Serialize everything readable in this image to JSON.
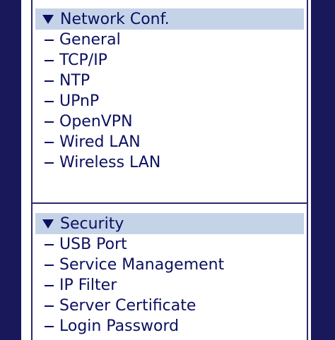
{
  "network": {
    "title": "Network Conf.",
    "items": [
      {
        "label": "General"
      },
      {
        "label": "TCP/IP"
      },
      {
        "label": "NTP"
      },
      {
        "label": "UPnP"
      },
      {
        "label": "OpenVPN"
      },
      {
        "label": "Wired LAN"
      },
      {
        "label": "Wireless LAN"
      }
    ]
  },
  "security": {
    "title": "Security",
    "items": [
      {
        "label": "USB Port"
      },
      {
        "label": "Service Management"
      },
      {
        "label": "IP Filter"
      },
      {
        "label": "Server Certificate"
      },
      {
        "label": "Login Password"
      }
    ]
  },
  "colors": {
    "navy": "#18185a",
    "header_bg": "#c5d3e8",
    "text": "#0b1060"
  }
}
